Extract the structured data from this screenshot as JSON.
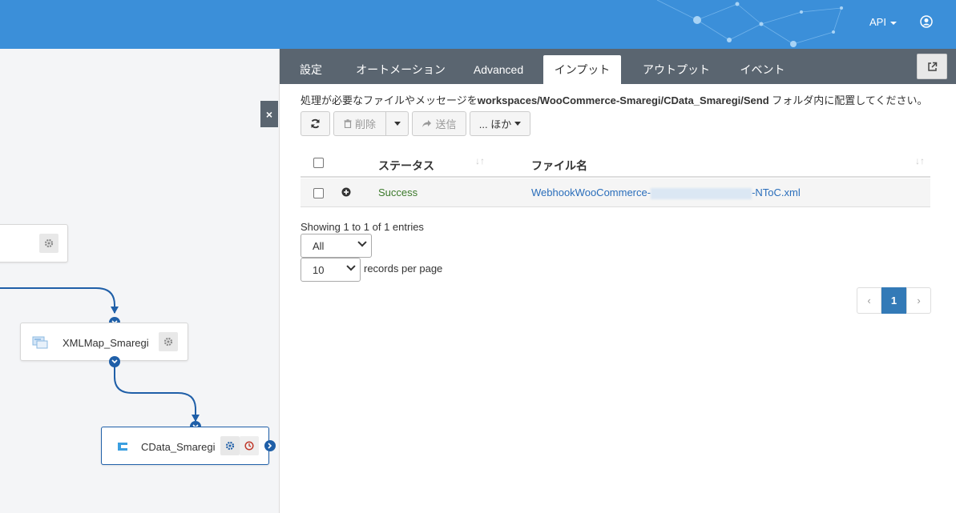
{
  "header": {
    "api_label": "API"
  },
  "canvas": {
    "nodes": [
      {
        "label": ""
      },
      {
        "label": "XMLMap_Smaregi"
      },
      {
        "label": "CData_Smaregi"
      }
    ],
    "collapse_label": "×"
  },
  "panel": {
    "tabs": [
      {
        "label": "設定"
      },
      {
        "label": "オートメーション"
      },
      {
        "label": "Advanced"
      },
      {
        "label": "インプット"
      },
      {
        "label": "アウトプット"
      },
      {
        "label": "イベント"
      }
    ],
    "active_tab": "インプット",
    "instruction_prefix": "処理が必要なファイルやメッセージを",
    "instruction_path": "workspaces/WooCommerce-Smaregi/CData_Smaregi/Send",
    "instruction_suffix": " フォルダ内に配置してください。",
    "toolbar": {
      "delete_label": "削除",
      "send_label": "送信",
      "more_label": "... ほか"
    },
    "table": {
      "columns": [
        "ステータス",
        "ファイル名"
      ],
      "rows": [
        {
          "status": "Success",
          "file_prefix": "WebhookWooCommerce-",
          "file_suffix": "-NToC.xml"
        }
      ]
    },
    "showing_text": "Showing 1 to 1 of 1 entries",
    "filter_value": "All",
    "page_size_value": "10",
    "records_per_page_label": "records per page",
    "pagination": {
      "prev": "‹",
      "current": "1",
      "next": "›"
    }
  },
  "colors": {
    "header_bg": "#3b8fd9",
    "tabbar_bg": "#5a6570",
    "success": "#3c7a2b",
    "link": "#2a6ebb",
    "connector": "#1f5fa8"
  }
}
